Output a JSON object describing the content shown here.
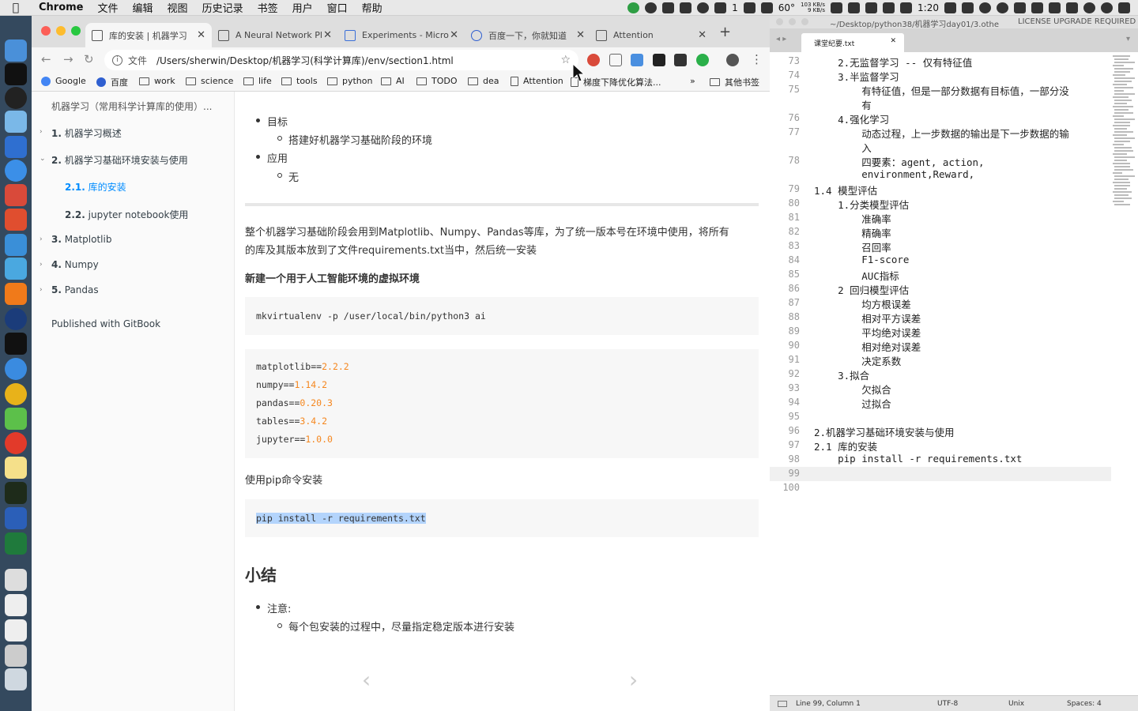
{
  "menubar": {
    "app": "Chrome",
    "items": [
      "文件",
      "编辑",
      "视图",
      "历史记录",
      "书签",
      "用户",
      "窗口",
      "帮助"
    ],
    "tray": {
      "notif_count": "1",
      "temp": "60°",
      "net_up": "103 KB/s",
      "net_down": "9 KB/s",
      "battery_time": "1:20"
    }
  },
  "chrome": {
    "tabs": [
      {
        "label": "库的安装 | 机器学习",
        "icon": "book-icon"
      },
      {
        "label": "A Neural Network Pl",
        "icon": "page-icon"
      },
      {
        "label": "Experiments - Micro",
        "icon": "flask-icon"
      },
      {
        "label": "百度一下，你就知道",
        "icon": "baidu-paw-icon"
      },
      {
        "label": "Attention",
        "icon": "document-icon"
      }
    ],
    "new_tab": "+",
    "address": {
      "scheme": "文件",
      "url": "/Users/sherwin/Desktop/机器学习(科学计算库)/env/section1.html"
    },
    "bookmarks": [
      "Google",
      "百度",
      "work",
      "science",
      "life",
      "tools",
      "python",
      "AI",
      "TODO",
      "dea",
      "Attention",
      "梯度下降优化算法..."
    ],
    "bookmarks_overflow": "»",
    "other_bookmarks": "其他书签"
  },
  "summary": {
    "title": "机器学习（常用科学计算库的使用）...",
    "items": [
      {
        "num": "1.",
        "label": "机器学习概述"
      },
      {
        "num": "2.",
        "label": "机器学习基础环境安装与使用"
      },
      {
        "num": "2.1.",
        "label": "库的安装"
      },
      {
        "num": "2.2.",
        "label": "jupyter notebook使用"
      },
      {
        "num": "3.",
        "label": "Matplotlib"
      },
      {
        "num": "4.",
        "label": "Numpy"
      },
      {
        "num": "5.",
        "label": "Pandas"
      }
    ],
    "footer": "Published with GitBook"
  },
  "content": {
    "goal_label": "目标",
    "goal_item": "搭建好机器学习基础阶段的环境",
    "apply_label": "应用",
    "apply_item": "无",
    "intro_line1": "整个机器学习基础阶段会用到Matplotlib、Numpy、Pandas等库，为了统一版本号在环境中使用，将所有",
    "intro_line2": "的库及其版本放到了文件requirements.txt当中，然后统一安装",
    "venv_heading": "新建一个用于人工智能环境的虚拟环境",
    "venv_cmd": "mkvirtualenv -p /user/local/bin/python3 ai",
    "requirements": [
      {
        "pkg": "matplotlib==",
        "ver": "2.2.2"
      },
      {
        "pkg": "numpy==",
        "ver": "1.14.2"
      },
      {
        "pkg": "pandas==",
        "ver": "0.20.3"
      },
      {
        "pkg": "tables==",
        "ver": "3.4.2"
      },
      {
        "pkg": "jupyter==",
        "ver": "1.0.0"
      }
    ],
    "pip_label": "使用pip命令安装",
    "pip_cmd": "pip install -r requirements.txt",
    "summary_heading": "小结",
    "note_label": "注意:",
    "note_item": "每个包安装的过程中，尽量指定稳定版本进行安装",
    "prev": "‹",
    "next": "›"
  },
  "sublime": {
    "path": "~/Desktop/python38/机器学习day01/3.othe",
    "license": "LICENSE UPGRADE REQUIRED",
    "tab": "课堂纪要.txt",
    "lines": [
      {
        "n": "73",
        "t": "    2.无监督学习 -- 仅有特征值"
      },
      {
        "n": "74",
        "t": "    3.半监督学习"
      },
      {
        "n": "75",
        "t": "        有特征值，但是一部分数据有目标值，一部分没"
      },
      {
        "n": "",
        "t": "        有"
      },
      {
        "n": "76",
        "t": "    4.强化学习"
      },
      {
        "n": "77",
        "t": "        动态过程，上一步数据的输出是下一步数据的输"
      },
      {
        "n": "",
        "t": "        入"
      },
      {
        "n": "78",
        "t": "        四要素：agent, action,"
      },
      {
        "n": "",
        "t": "        environment,Reward,"
      },
      {
        "n": "79",
        "t": "1.4 模型评估"
      },
      {
        "n": "80",
        "t": "    1.分类模型评估"
      },
      {
        "n": "81",
        "t": "        准确率"
      },
      {
        "n": "82",
        "t": "        精确率"
      },
      {
        "n": "83",
        "t": "        召回率"
      },
      {
        "n": "84",
        "t": "        F1-score"
      },
      {
        "n": "85",
        "t": "        AUC指标"
      },
      {
        "n": "86",
        "t": "    2 回归模型评估"
      },
      {
        "n": "87",
        "t": "        均方根误差"
      },
      {
        "n": "88",
        "t": "        相对平方误差"
      },
      {
        "n": "89",
        "t": "        平均绝对误差"
      },
      {
        "n": "90",
        "t": "        相对绝对误差"
      },
      {
        "n": "91",
        "t": "        决定系数"
      },
      {
        "n": "92",
        "t": "    3.拟合"
      },
      {
        "n": "93",
        "t": "        欠拟合"
      },
      {
        "n": "94",
        "t": "        过拟合"
      },
      {
        "n": "95",
        "t": ""
      },
      {
        "n": "96",
        "t": "2.机器学习基础环境安装与使用"
      },
      {
        "n": "97",
        "t": "2.1 库的安装"
      },
      {
        "n": "98",
        "t": "    pip install -r requirements.txt"
      },
      {
        "n": "99",
        "t": ""
      },
      {
        "n": "100",
        "t": ""
      }
    ],
    "status": {
      "position": "Line 99, Column 1",
      "encoding": "UTF-8",
      "line_endings": "Unix",
      "indent": "Spaces: 4"
    }
  }
}
